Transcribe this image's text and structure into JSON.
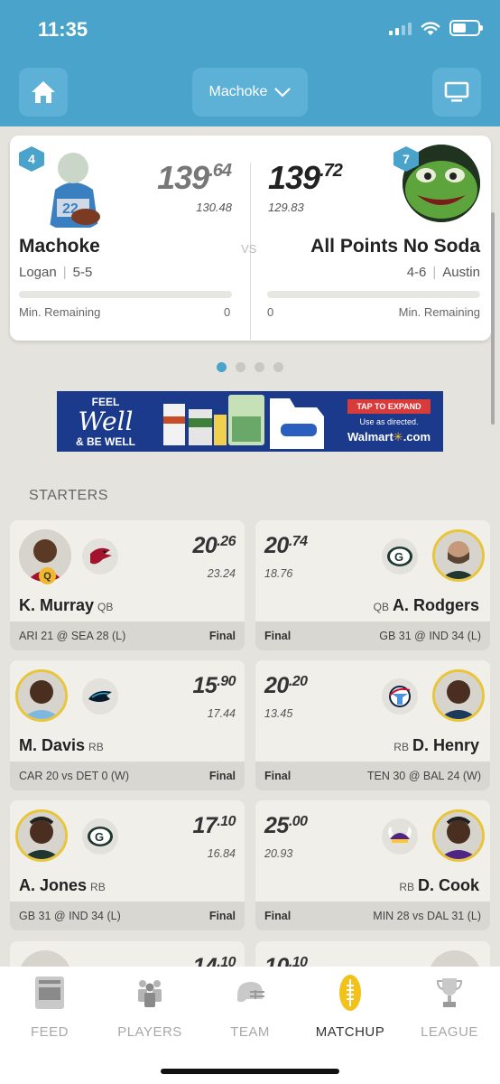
{
  "status_bar": {
    "time": "11:35"
  },
  "header": {
    "team_selector": "Machoke"
  },
  "matchup": {
    "left": {
      "rank": "4",
      "score_whole": "139",
      "score_decimal": ".64",
      "projected": "130.48",
      "team_name": "Machoke",
      "owner": "Logan",
      "record": "5-5",
      "min_remaining_label": "Min. Remaining",
      "min_remaining": "0"
    },
    "vs_label": "VS",
    "right": {
      "rank": "7",
      "score_whole": "139",
      "score_decimal": ".72",
      "projected": "129.83",
      "team_name": "All Points No Soda",
      "owner": "Austin",
      "record": "4-6",
      "min_remaining_label": "Min. Remaining",
      "min_remaining": "0"
    }
  },
  "ad": {
    "line1": "FEEL",
    "line2": "Well",
    "line3": "& BE WELL",
    "tap": "TAP TO EXPAND",
    "use": "Use as directed.",
    "brand": "Walmart",
    "domain": ".com"
  },
  "section_title": "STARTERS",
  "starters": [
    {
      "left": {
        "name": "K. Murray",
        "pos": "QB",
        "score_whole": "20",
        "score_decimal": ".26",
        "projected": "23.24",
        "game": "ARI 21 @ SEA 28 (L)",
        "status": "Final",
        "badge": "Q"
      },
      "right": {
        "name": "A. Rodgers",
        "pos": "QB",
        "score_whole": "20",
        "score_decimal": ".74",
        "projected": "18.76",
        "game": "GB 31 @ IND 34 (L)",
        "status": "Final"
      }
    },
    {
      "left": {
        "name": "M. Davis",
        "pos": "RB",
        "score_whole": "15",
        "score_decimal": ".90",
        "projected": "17.44",
        "game": "CAR 20 vs DET 0 (W)",
        "status": "Final"
      },
      "right": {
        "name": "D. Henry",
        "pos": "RB",
        "score_whole": "20",
        "score_decimal": ".20",
        "projected": "13.45",
        "game": "TEN 30 @ BAL 24 (W)",
        "status": "Final"
      }
    },
    {
      "left": {
        "name": "A. Jones",
        "pos": "RB",
        "score_whole": "17",
        "score_decimal": ".10",
        "projected": "16.84",
        "game": "GB 31 @ IND 34 (L)",
        "status": "Final"
      },
      "right": {
        "name": "D. Cook",
        "pos": "RB",
        "score_whole": "25",
        "score_decimal": ".00",
        "projected": "20.93",
        "game": "MIN 28 vs DAL 31 (L)",
        "status": "Final"
      }
    },
    {
      "left": {
        "score_whole": "14",
        "score_decimal": ".10"
      },
      "right": {
        "score_whole": "10",
        "score_decimal": ".10"
      }
    }
  ],
  "nav": {
    "feed": "FEED",
    "players": "PLAYERS",
    "team": "TEAM",
    "matchup": "MATCHUP",
    "league": "LEAGUE",
    "active": "matchup"
  },
  "colors": {
    "header": "#4aa3cb",
    "accent_gold": "#e8c53a",
    "background": "#e4e3de"
  }
}
